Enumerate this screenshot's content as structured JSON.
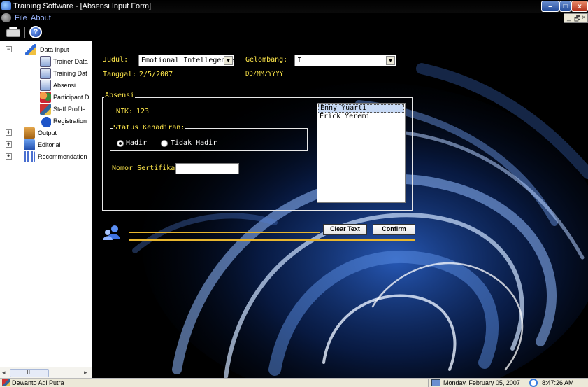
{
  "window": {
    "title": "Training Software - [Absensi Input Form]",
    "minimize_glyph": "–",
    "maximize_glyph": "□",
    "close_glyph": "x"
  },
  "menu": {
    "items": [
      "File",
      "About"
    ],
    "mdi_minimize": "_",
    "mdi_restore": "🗗",
    "mdi_close": "×"
  },
  "toolbar": {
    "help_glyph": "?"
  },
  "tree": {
    "nodes": [
      {
        "label": "Data Input",
        "expander": "−",
        "icon": "data-input-icon"
      },
      {
        "label": "Trainer Data",
        "icon": "document-icon"
      },
      {
        "label": "Training Dat",
        "icon": "document-icon"
      },
      {
        "label": "Absensi",
        "icon": "document-icon"
      },
      {
        "label": "Participant D",
        "icon": "participant-icon"
      },
      {
        "label": "Staff Profile",
        "icon": "staff-icon"
      },
      {
        "label": "Registration",
        "icon": "registration-icon"
      },
      {
        "label": "Output",
        "expander": "+",
        "icon": "output-icon"
      },
      {
        "label": "Editorial",
        "expander": "+",
        "icon": "editorial-icon"
      },
      {
        "label": "Recommendation",
        "expander": "+",
        "icon": "recommendation-icon"
      }
    ],
    "hscroll_left": "◂",
    "hscroll_thumb": "III",
    "hscroll_right": "▸"
  },
  "form": {
    "judul_label": "Judul:",
    "judul_value": "Emotional Intellegence",
    "gelombang_label": "Gelombang:",
    "gelombang_value": "I",
    "tanggal_label": "Tanggal:",
    "tanggal_value": "2/5/2007",
    "date_format_hint": "DD/MM/YYYY",
    "absensi_group_title": "Absensi",
    "nik_label": "NIK:",
    "nik_value": "123",
    "status_group_title": "Status Kehadiran:",
    "radio_hadir": "Hadir",
    "radio_tidak_hadir": "Tidak Hadir",
    "radio_selected": "Hadir",
    "nomor_sertifikat_label": "Nomor Sertifikat:",
    "nomor_sertifikat_value": "",
    "participants": [
      "Enny Yuarti",
      "Erick Yeremi"
    ],
    "selected_participant": "Enny Yuarti",
    "dropdown_glyph": "▼"
  },
  "actions": {
    "clear_text_label": "Clear Text",
    "confirm_label": "Confirm"
  },
  "statusbar": {
    "user": "Dewanto Adi Putra",
    "date": "Monday, February 05, 2007",
    "time": "8:47:26 AM"
  },
  "colors": {
    "accent_text": "#ffe84a",
    "separator_line": "#e8b62e",
    "menu_text": "#9bb6ff"
  }
}
